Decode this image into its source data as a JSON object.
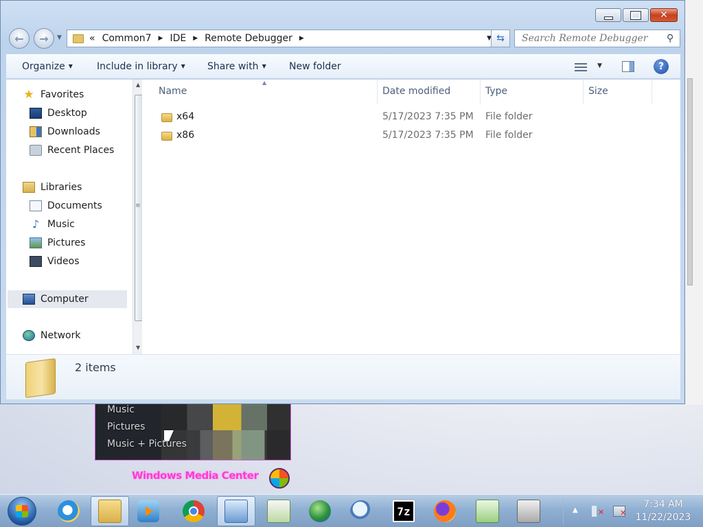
{
  "window": {
    "address": {
      "overflow_glyph": "«",
      "breadcrumbs": [
        "Common7",
        "IDE",
        "Remote Debugger"
      ]
    },
    "search": {
      "placeholder": "Search Remote Debugger"
    },
    "command_bar": {
      "organize": "Organize",
      "include_in_library": "Include in library",
      "share_with": "Share with",
      "new_folder": "New folder"
    },
    "nav_pane": {
      "favorites": "Favorites",
      "desktop": "Desktop",
      "downloads": "Downloads",
      "recent_places": "Recent Places",
      "libraries": "Libraries",
      "documents": "Documents",
      "music": "Music",
      "pictures": "Pictures",
      "videos": "Videos",
      "computer": "Computer",
      "network": "Network"
    },
    "columns": {
      "name": "Name",
      "date_modified": "Date modified",
      "type": "Type",
      "size": "Size"
    },
    "files": [
      {
        "name": "x64",
        "date_modified": "5/17/2023 7:35 PM",
        "type": "File folder"
      },
      {
        "name": "x86",
        "date_modified": "5/17/2023 7:35 PM",
        "type": "File folder"
      }
    ],
    "details": {
      "item_count": "2 items"
    }
  },
  "desktop": {
    "media_center_menu": [
      "Music",
      "Pictures",
      "Music + Pictures"
    ],
    "media_center_logo": "Windows Media Center"
  },
  "taskbar": {
    "pinned": [
      "internet-explorer-icon",
      "windows-explorer-icon",
      "media-player-icon",
      "chrome-icon",
      "remote-desktop-icon",
      "task-scheduler-icon",
      "globe-download-icon",
      "magnifier-icon",
      "7zip-icon",
      "firefox-icon",
      "notepad-icon",
      "fax-icon"
    ],
    "sevenzip_label": "7z",
    "clock": {
      "time": "7:34 AM",
      "date": "11/22/2023"
    }
  }
}
